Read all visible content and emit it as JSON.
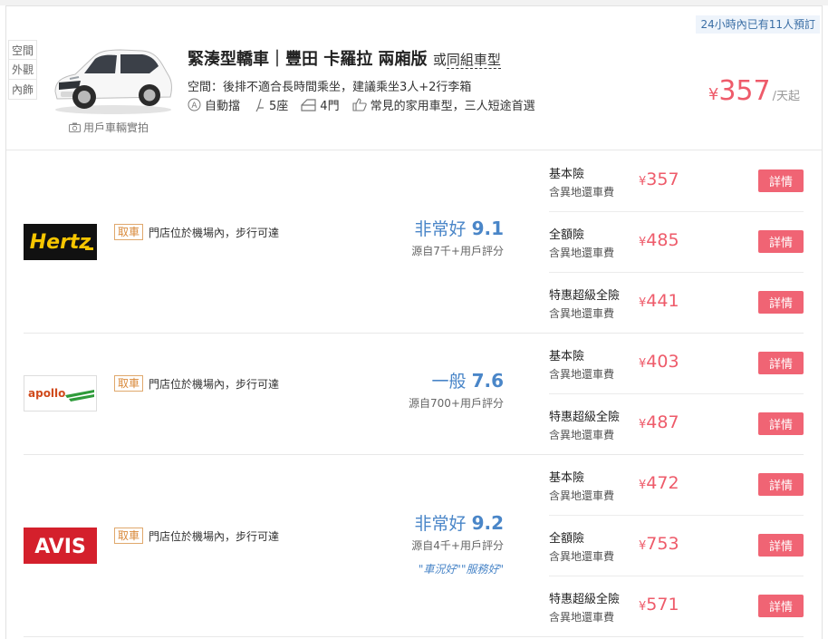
{
  "header": {
    "booked_badge": "24小時內已有11人預訂",
    "view_tabs": [
      "空間",
      "外觀",
      "內飾"
    ],
    "photo_caption": "用戶車輛實拍",
    "car_title": "緊湊型轎車｜豐田 卡羅拉 兩廂版",
    "or_prefix": "或",
    "or_similar": "同組車型",
    "space_text": "空間：後排不適合長時間乘坐，建議乘坐3人+2行李箱",
    "specs": {
      "transmission": "自動擋",
      "seats": "5座",
      "doors": "4門",
      "note": "常見的家用車型，三人短途首選"
    },
    "price": {
      "currency": "¥",
      "value": "357",
      "unit": "/天起"
    }
  },
  "vendors": [
    {
      "name": "Hertz",
      "pickup_tag": "取車",
      "pickup_text": "門店位於機場內，步行可達",
      "rating_label": "非常好",
      "rating_score": "9.1",
      "rating_source": "源自7千+用戶評分",
      "plans": [
        {
          "name": "基本險",
          "sub": "含異地還車費",
          "currency": "¥",
          "price": "357",
          "button": "詳情"
        },
        {
          "name": "全額險",
          "sub": "含異地還車費",
          "currency": "¥",
          "price": "485",
          "button": "詳情"
        },
        {
          "name": "特惠超級全險",
          "sub": "含異地還車費",
          "currency": "¥",
          "price": "441",
          "button": "詳情"
        }
      ]
    },
    {
      "name": "apollo",
      "pickup_tag": "取車",
      "pickup_text": "門店位於機場內，步行可達",
      "rating_label": "一般",
      "rating_score": "7.6",
      "rating_source": "源自700+用戶評分",
      "plans": [
        {
          "name": "基本險",
          "sub": "含異地還車費",
          "currency": "¥",
          "price": "403",
          "button": "詳情"
        },
        {
          "name": "特惠超級全險",
          "sub": "含異地還車費",
          "currency": "¥",
          "price": "487",
          "button": "詳情"
        }
      ]
    },
    {
      "name": "AVIS",
      "pickup_tag": "取車",
      "pickup_text": "門店位於機場內，步行可達",
      "rating_label": "非常好",
      "rating_score": "9.2",
      "rating_source": "源自4千+用戶評分",
      "rating_tags": "\"車況好\"\"服務好\"",
      "plans": [
        {
          "name": "基本險",
          "sub": "含異地還車費",
          "currency": "¥",
          "price": "472",
          "button": "詳情"
        },
        {
          "name": "全額險",
          "sub": "含異地還車費",
          "currency": "¥",
          "price": "753",
          "button": "詳情"
        },
        {
          "name": "特惠超級全險",
          "sub": "含異地還車費",
          "currency": "¥",
          "price": "571",
          "button": "詳情"
        }
      ]
    }
  ],
  "colors": {
    "accent_price": "#ee5b6a",
    "detail_button": "#f06474",
    "rating_blue": "#4a86c8",
    "pickup_tag": "#d98a3b",
    "hertz_yellow": "#f7c600",
    "avis_red": "#d4202c",
    "apollo_green": "#2e9b3a"
  }
}
